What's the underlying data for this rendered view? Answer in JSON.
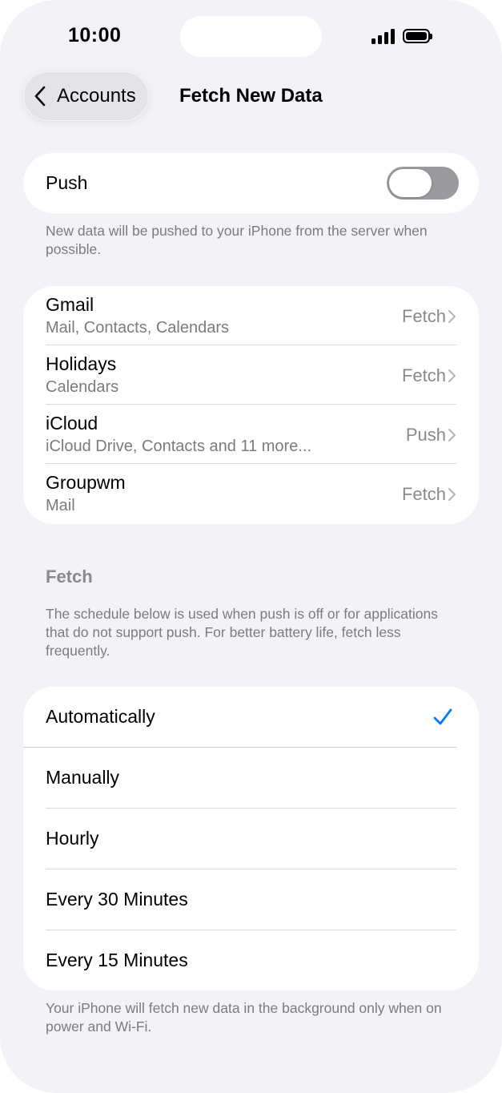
{
  "status_bar": {
    "time": "10:00"
  },
  "nav": {
    "back_label": "Accounts",
    "title": "Fetch New Data"
  },
  "push": {
    "label": "Push",
    "enabled": false,
    "footer": "New data will be pushed to your iPhone from the server when possible."
  },
  "accounts": [
    {
      "name": "Gmail",
      "services": "Mail, Contacts, Calendars",
      "mode": "Fetch"
    },
    {
      "name": "Holidays",
      "services": "Calendars",
      "mode": "Fetch"
    },
    {
      "name": "iCloud",
      "services": "iCloud Drive, Contacts and 11 more...",
      "mode": "Push"
    },
    {
      "name": "Groupwm",
      "services": "Mail",
      "mode": "Fetch"
    }
  ],
  "fetch": {
    "header": "Fetch",
    "description": "The schedule below is used when push is off or for applications that do not support push. For better battery life, fetch less frequently.",
    "options": [
      "Automatically",
      "Manually",
      "Hourly",
      "Every 30 Minutes",
      "Every 15 Minutes"
    ],
    "selected": "Automatically",
    "footer": "Your iPhone will fetch new data in the background only when on power and Wi-Fi."
  },
  "colors": {
    "background": "#f2f2f7",
    "card": "#ffffff",
    "accent": "#007aff",
    "secondary_text": "#7b7b80",
    "toggle_off": "#9a9a9f"
  },
  "icons": {
    "back": "chevron-left-icon",
    "disclosure": "chevron-right-icon",
    "selected": "checkmark-icon"
  }
}
